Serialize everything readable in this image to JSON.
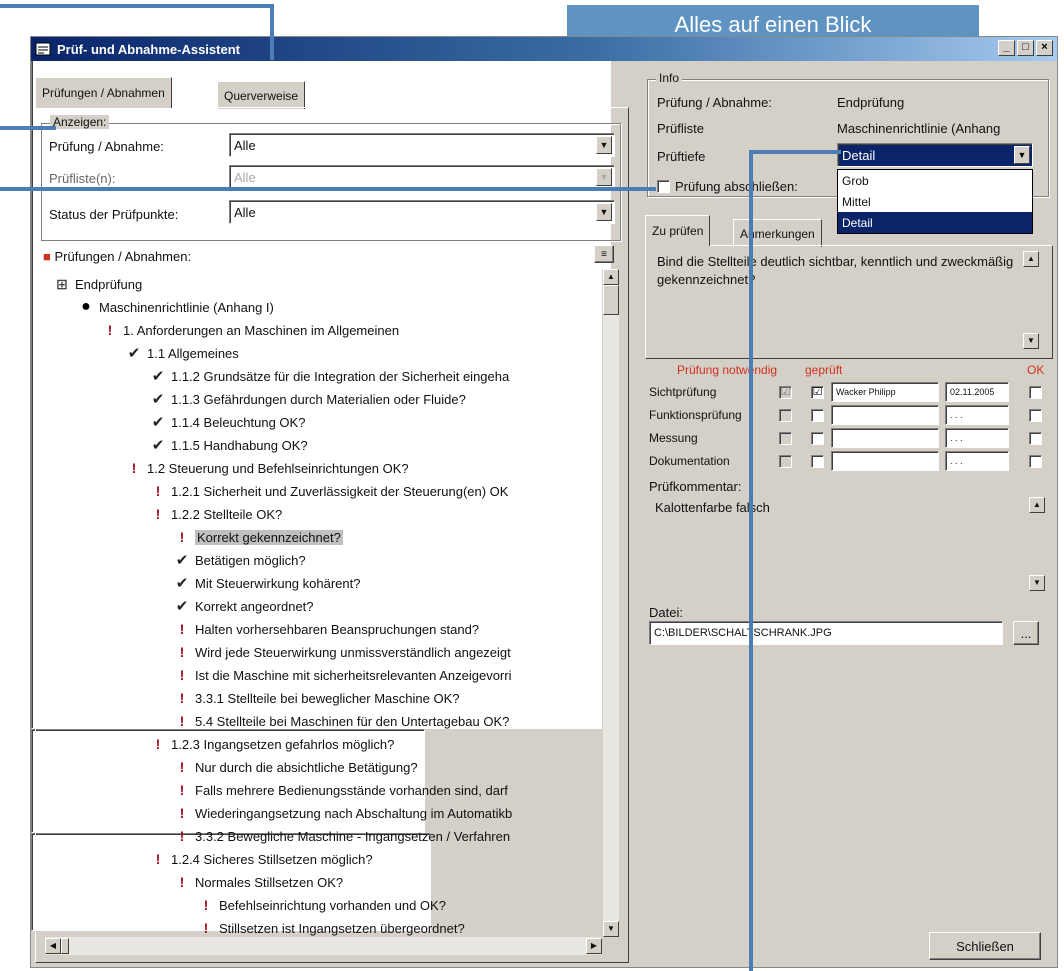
{
  "banner": "Alles auf einen Blick",
  "window": {
    "title": "Prüf- und Abnahme-Assistent",
    "min": "_",
    "max": "□",
    "close": "×"
  },
  "left": {
    "tabs": [
      "Prüfungen / Abnahmen",
      "Querverweise"
    ],
    "anzeigen_title": "Anzeigen:",
    "fields": [
      {
        "label": "Prüfung / Abnahme:",
        "value": "Alle"
      },
      {
        "label": "Prüfliste(n):",
        "value": "Alle"
      },
      {
        "label": "Status der Prüfpunkte:",
        "value": "Alle"
      }
    ],
    "tree_header": "Prüfungen / Abnahmen:",
    "tree": [
      {
        "icon": "folder",
        "text": "Endprüfung"
      },
      {
        "icon": "dot",
        "text": "Maschinenrichtlinie (Anhang I)"
      },
      {
        "icon": "bang",
        "text": "1. Anforderungen an Maschinen im Allgemeinen"
      },
      {
        "icon": "check",
        "text": "1.1 Allgemeines"
      },
      {
        "icon": "check",
        "text": "1.1.2 Grundsätze für die Integration der Sicherheit eingeha"
      },
      {
        "icon": "check",
        "text": "1.1.3 Gefährdungen durch Materialien oder Fluide?"
      },
      {
        "icon": "check",
        "text": "1.1.4 Beleuchtung OK?"
      },
      {
        "icon": "check",
        "text": "1.1.5 Handhabung OK?"
      },
      {
        "icon": "bang",
        "text": "1.2 Steuerung und Befehlseinrichtungen OK?"
      },
      {
        "icon": "bang",
        "text": "1.2.1 Sicherheit und Zuverlässigkeit der Steuerung(en) OK"
      },
      {
        "icon": "bang",
        "text": "1.2.2 Stellteile OK?"
      },
      {
        "icon": "bang",
        "text": "Korrekt gekennzeichnet?"
      },
      {
        "icon": "check",
        "text": "Betätigen möglich?"
      },
      {
        "icon": "check",
        "text": "Mit Steuerwirkung kohärent?"
      },
      {
        "icon": "check",
        "text": "Korrekt angeordnet?"
      },
      {
        "icon": "bang",
        "text": "Halten vorhersehbaren Beanspruchungen stand?"
      },
      {
        "icon": "bang",
        "text": "Wird jede Steuerwirkung unmissverständlich angezeigt"
      },
      {
        "icon": "bang",
        "text": "Ist die Maschine mit sicherheitsrelevanten Anzeigevorri"
      },
      {
        "icon": "bang",
        "text": "3.3.1 Stellteile bei beweglicher Maschine OK?"
      },
      {
        "icon": "bang",
        "text": "5.4 Stellteile bei Maschinen für den Untertagebau OK?"
      },
      {
        "icon": "bang",
        "text": "1.2.3 Ingangsetzen gefahrlos möglich?"
      },
      {
        "icon": "bang",
        "text": "Nur durch die absichtliche Betätigung?"
      },
      {
        "icon": "bang",
        "text": "Falls mehrere Bedienungsstände vorhanden sind, darf"
      },
      {
        "icon": "bang",
        "text": "Wiederingangsetzung nach Abschaltung im Automatikb"
      },
      {
        "icon": "bang",
        "text": "3.3.2 Bewegliche Maschine - Ingangsetzen / Verfahren"
      },
      {
        "icon": "bang",
        "text": "1.2.4 Sicheres Stillsetzen möglich?"
      },
      {
        "icon": "bang",
        "text": "Normales Stillsetzen OK?"
      },
      {
        "icon": "bang",
        "text": "Befehlseinrichtung vorhanden und OK?"
      },
      {
        "icon": "bang",
        "text": "Stillsetzen ist Ingangsetzen übergeordnet?"
      }
    ]
  },
  "right": {
    "info_title": "Info",
    "info": [
      {
        "label": "Prüfung / Abnahme:",
        "value": "Endprüfung"
      },
      {
        "label": "Prüfliste",
        "value": "Maschinenrichtlinie (Anhang"
      },
      {
        "label": "Prüftiefe",
        "value": ""
      }
    ],
    "pruftiefe_value": "Detail",
    "pruftiefe_options": [
      "Grob",
      "Mittel",
      "Detail"
    ],
    "abschliessen_label": "Prüfung abschließen:",
    "tabs": [
      "Zu prüfen",
      "Anmerkungen"
    ],
    "question": "Bind die Stellteile deutlich sichtbar, kenntlich und zweckmäßig gekennzeichnet?",
    "col_headers": {
      "notwendig": "Prüfung notwendig",
      "geprueft": "geprüft",
      "ok": "OK"
    },
    "checks": [
      {
        "label": "Sichtprüfung",
        "name": "Wacker Philipp",
        "date": "02.11.2005",
        "notwendig": "☑",
        "geprueft": "☑"
      },
      {
        "label": "Funktionsprüfung",
        "name": "",
        "date": ". . .",
        "notwendig": "",
        "geprueft": ""
      },
      {
        "label": "Messung",
        "name": "",
        "date": ". . .",
        "notwendig": "",
        "geprueft": ""
      },
      {
        "label": "Dokumentation",
        "name": "",
        "date": ". . .",
        "notwendig": "",
        "geprueft": ""
      }
    ],
    "kommentar_label": "Prüfkommentar:",
    "kommentar": "Kalottenfarbe falsch",
    "datei_label": "Datei:",
    "datei": "C:\\BILDER\\SCHALTSCHRANK.JPG",
    "browse": "...",
    "close_button": "Schließen"
  }
}
